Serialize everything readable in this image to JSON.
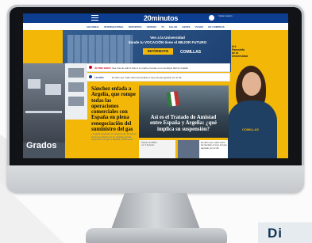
{
  "site": {
    "logo": "20minutos",
    "nav": [
      "NACIONAL",
      "INTERNACIONAL",
      "DEPORTES",
      "VERSOS",
      "TV",
      "SALUD",
      "GENTE",
      "VIAJES",
      "DE COMPRAS"
    ],
    "user_text": "Iniciar sesión"
  },
  "ad": {
    "title_line1": "Ven a la Universidad",
    "title_line2": "donde tu VOCACIÓN tiene el MEJOR FUTURO",
    "cta": "INFÓRMATE",
    "brand": "COMILLAS",
    "tag": "Nº1 Paraninfo de la Universidad",
    "shirt_brand": "COMILLAS",
    "grados": "Grados"
  },
  "alerts": [
    {
      "label": "ÚLTIMA HORA",
      "text": "Sea más de cuál el Gran a su madre promete en el municipio fácil de Castilla"
    },
    {
      "label": "LO MÁS",
      "text": "El oficio que matió sobre las familias el tope del gas agotado por la UE"
    }
  ],
  "main": {
    "headline": "Sánchez enfada a Argelia, que rompe todas las operaciones comerciales con España en plena renegociación del suministro del gas",
    "meta": "» Argelia suspende su compromiso. El Gas el precio de petróleo en su contrato para la exportación de gas a España y Marruecos",
    "photo_title": "Así es el Tratado de Amistad entre España y Argelia: ¿qué implica su suspensión?",
    "thumb1_text": "Hoteles del BBVA con 3 Estrellas",
    "thumb2_text": "El oficio que matió sobre las familias el tope del gas agotado por la UE"
  },
  "corner_badge": "Di"
}
